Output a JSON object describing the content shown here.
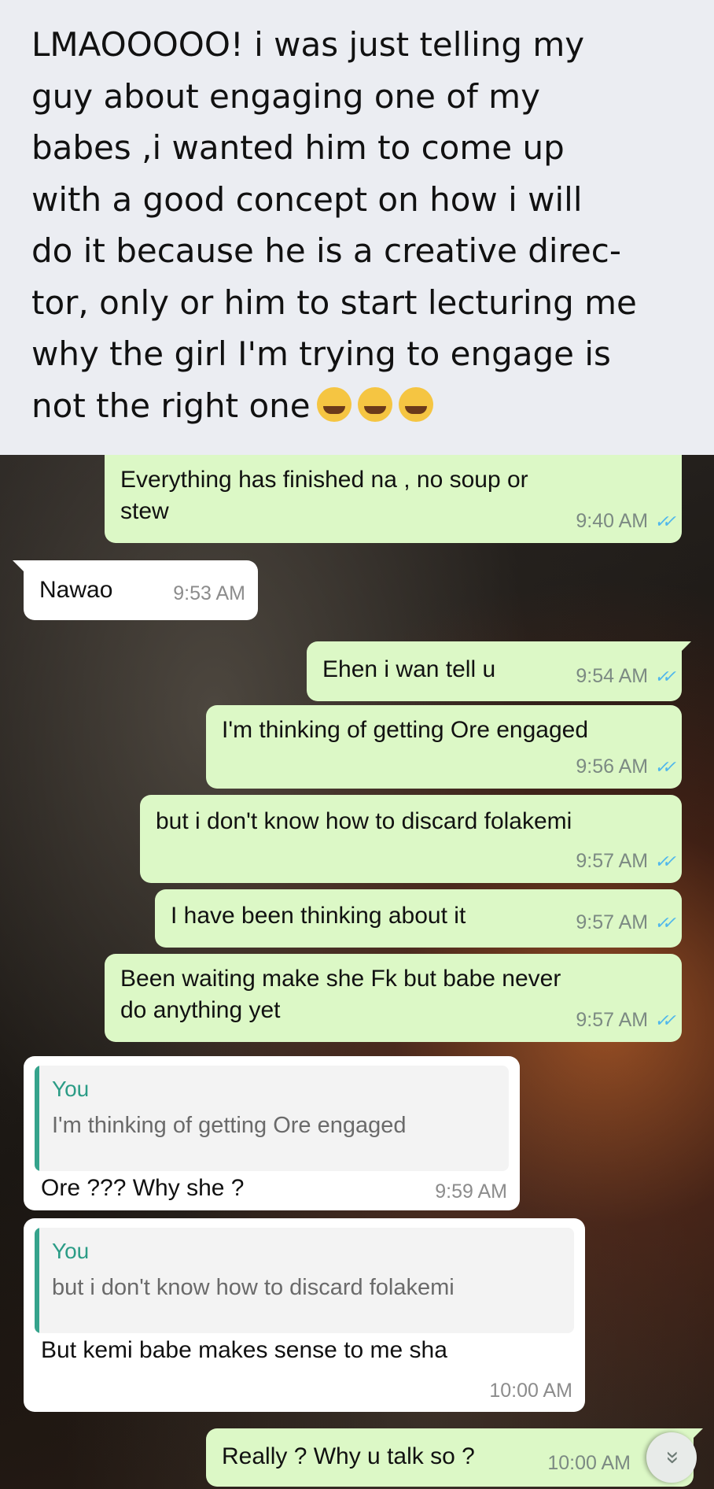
{
  "caption": {
    "lines": [
      "LMAOOOOO! i was just telling my",
      "guy about engaging one of my",
      "babes ,i wanted him to come up",
      "with a good concept on how i will",
      "do it because he is a creative direc-",
      "tor, only or him to start lecturing me",
      "why the girl I'm trying to engage is",
      "not the right one"
    ],
    "emojis": [
      "tears-of-joy",
      "rolling-on-floor-laughing",
      "rolling-on-floor-laughing"
    ]
  },
  "messages": [
    {
      "id": "m1",
      "direction": "out",
      "lines": [
        "Everything has finished na , no soup or",
        "stew"
      ],
      "time": "9:40 AM",
      "read": true
    },
    {
      "id": "m2",
      "direction": "in",
      "lines": [
        "Nawao"
      ],
      "time": "9:53 AM"
    },
    {
      "id": "m3",
      "direction": "out",
      "lines": [
        "Ehen i wan tell u"
      ],
      "time": "9:54 AM",
      "read": true
    },
    {
      "id": "m4",
      "direction": "out",
      "lines": [
        "I'm thinking of getting Ore engaged"
      ],
      "time": "9:56 AM",
      "read": true
    },
    {
      "id": "m5",
      "direction": "out",
      "lines": [
        "but i don't know how to discard folakemi"
      ],
      "time": "9:57 AM",
      "read": true
    },
    {
      "id": "m6",
      "direction": "out",
      "lines": [
        "I have been thinking about it"
      ],
      "time": "9:57 AM",
      "read": true
    },
    {
      "id": "m7",
      "direction": "out",
      "lines": [
        "Been waiting make she Fk but babe never",
        "do anything yet"
      ],
      "time": "9:57 AM",
      "read": true
    },
    {
      "id": "m8",
      "direction": "in",
      "quote": {
        "author": "You",
        "text": "I'm thinking of getting Ore engaged"
      },
      "lines": [
        "Ore ??? Why she ?"
      ],
      "time": "9:59 AM"
    },
    {
      "id": "m9",
      "direction": "in",
      "quote": {
        "author": "You",
        "text": "but i don't know how to discard folakemi"
      },
      "lines": [
        "But kemi babe makes sense to me sha"
      ],
      "time": "10:00 AM"
    },
    {
      "id": "m10",
      "direction": "out",
      "lines": [
        "Really ? Why u talk so ?"
      ],
      "time": "10:00 AM",
      "read": true
    }
  ],
  "icons": {
    "read_receipt": "double-check-icon",
    "scroll_down": "double-chevron-down-icon"
  },
  "colors": {
    "outgoing": "#dcf8c6",
    "incoming": "#ffffff",
    "tick": "#4fb6ec",
    "quote_bar": "#35a38c",
    "caption_bg": "#ebedf2"
  }
}
